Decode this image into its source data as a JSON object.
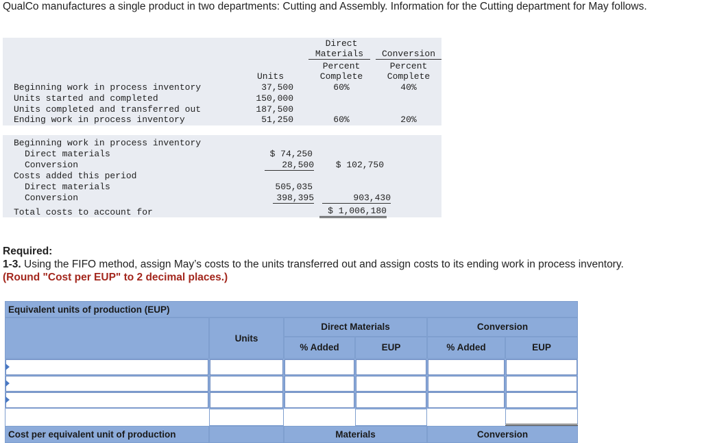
{
  "intro": "QualCo manufactures a single product in two departments: Cutting and Assembly. Information for the Cutting department for May follows.",
  "info_table": {
    "col_units": "Units",
    "col_dm": [
      "Direct",
      "Materials",
      "Percent",
      "Complete"
    ],
    "col_conv": [
      "Conversion",
      "Percent",
      "Complete"
    ],
    "rows": [
      {
        "label": "Beginning work in process inventory",
        "units": "37,500",
        "dm": "60%",
        "conv": "40%"
      },
      {
        "label": "Units started and completed",
        "units": "150,000",
        "dm": "",
        "conv": ""
      },
      {
        "label": "Units completed and transferred out",
        "units": "187,500",
        "dm": "",
        "conv": ""
      },
      {
        "label": "Ending work in process inventory",
        "units": "51,250",
        "dm": "60%",
        "conv": "20%"
      }
    ]
  },
  "cost_table": {
    "beg_label": "Beginning work in process inventory",
    "beg_dm_label": "Direct materials",
    "beg_dm_value": "$ 74,250",
    "beg_conv_label": "Conversion",
    "beg_conv_value": "28,500",
    "beg_total": "$ 102,750",
    "added_label": "Costs added this period",
    "added_dm_label": "Direct materials",
    "added_dm_value": "505,035",
    "added_conv_label": "Conversion",
    "added_conv_value": "398,395",
    "added_total": "903,430",
    "total_label": "Total costs to account for",
    "total_value": "$ 1,006,180"
  },
  "required": {
    "heading": "Required:",
    "question_num": "1-3.",
    "question": " Using the FIFO method, assign May’s costs to the units transferred out and assign costs to its ending work in process inventory.",
    "note": "(Round \"Cost per EUP\" to 2 decimal places.)"
  },
  "eup_grid": {
    "title": "Equivalent units of production (EUP)",
    "units": "Units",
    "dm": "Direct Materials",
    "conv": "Conversion",
    "pct_added": "% Added",
    "eup": "EUP",
    "cost_per_label": "Cost per equivalent unit of production",
    "materials": "Materials",
    "conversion": "Conversion"
  }
}
